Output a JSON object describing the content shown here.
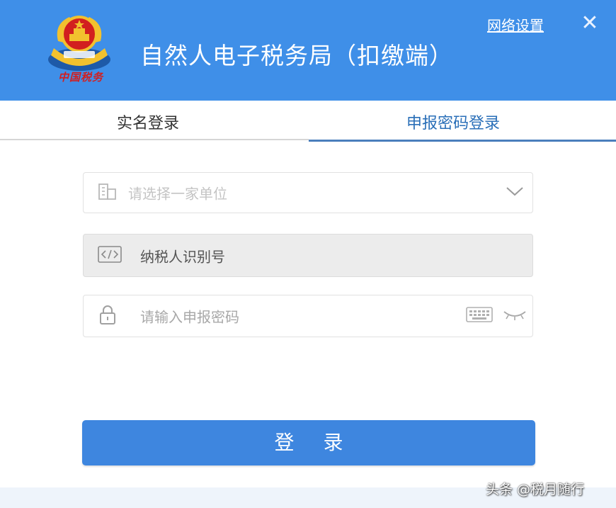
{
  "header": {
    "logo_text": "中国税务",
    "title": "自然人电子税务局（扣缴端）",
    "network_settings": "网络设置",
    "close_symbol": "✕"
  },
  "tabs": [
    {
      "label": "实名登录",
      "active": false
    },
    {
      "label": "申报密码登录",
      "active": true
    }
  ],
  "form": {
    "company": {
      "placeholder": "请选择一家单位",
      "icon": "building-icon"
    },
    "tax_id": {
      "value": "纳税人识别号",
      "icon": "code-icon"
    },
    "password": {
      "placeholder": "请输入申报密码",
      "icon": "lock-icon"
    }
  },
  "login_button": "登 录",
  "watermark": "头条 @税月随行",
  "colors": {
    "header_blue": "#3f8fe8",
    "button_blue": "#3e86df",
    "active_tab": "#2a6fb8",
    "emblem_red": "#d21f1f",
    "emblem_gold": "#f2c12e"
  }
}
